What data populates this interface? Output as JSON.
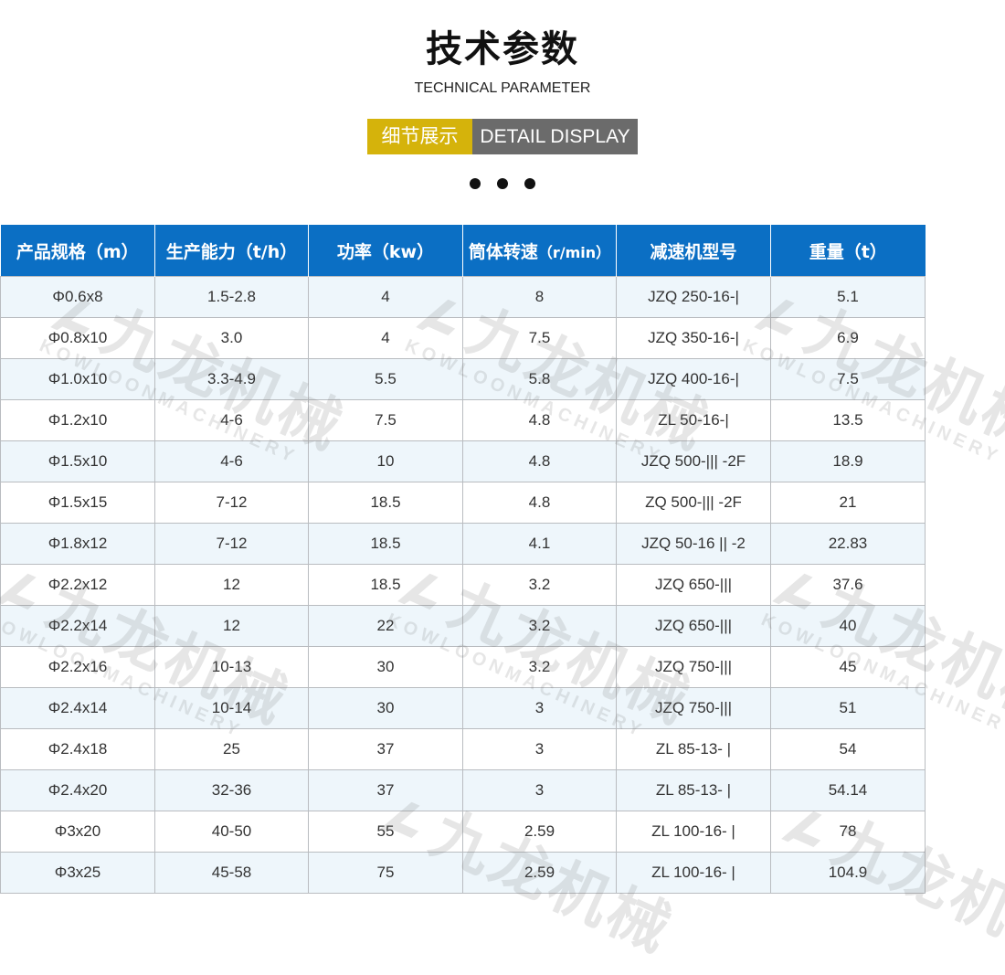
{
  "header": {
    "title": "技术参数",
    "subtitle": "TECHNICAL PARAMETER",
    "banner_cn": "细节展示",
    "banner_en": "DETAIL DISPLAY"
  },
  "watermark": {
    "text_cn": "九龙机械",
    "text_en": "KOWLOONMACHINERY"
  },
  "table": {
    "headers": [
      {
        "main": "产品规格",
        "unit": "（m）"
      },
      {
        "main": "生产能力",
        "unit": "（t/h）"
      },
      {
        "main": "功率",
        "unit": "（kw）"
      },
      {
        "main": "筒体转速",
        "unit": "（r/min）"
      },
      {
        "main": "减速机型号",
        "unit": ""
      },
      {
        "main": "重量",
        "unit": "（t）"
      }
    ],
    "rows": [
      [
        "Φ0.6x8",
        "1.5-2.8",
        "4",
        "8",
        "JZQ 250-16-|",
        "5.1"
      ],
      [
        "Φ0.8x10",
        "3.0",
        "4",
        "7.5",
        "JZQ 350-16-|",
        "6.9"
      ],
      [
        "Φ1.0x10",
        "3.3-4.9",
        "5.5",
        "5.8",
        "JZQ 400-16-|",
        "7.5"
      ],
      [
        "Φ1.2x10",
        "4-6",
        "7.5",
        "4.8",
        "ZL 50-16-|",
        "13.5"
      ],
      [
        "Φ1.5x10",
        "4-6",
        "10",
        "4.8",
        "JZQ 500-||| -2F",
        "18.9"
      ],
      [
        "Φ1.5x15",
        "7-12",
        "18.5",
        "4.8",
        "ZQ 500-||| -2F",
        "21"
      ],
      [
        "Φ1.8x12",
        "7-12",
        "18.5",
        "4.1",
        "JZQ 50-16 || -2",
        "22.83"
      ],
      [
        "Φ2.2x12",
        "12",
        "18.5",
        "3.2",
        "JZQ 650-|||",
        "37.6"
      ],
      [
        "Φ2.2x14",
        "12",
        "22",
        "3.2",
        "JZQ 650-|||",
        "40"
      ],
      [
        "Φ2.2x16",
        "10-13",
        "30",
        "3.2",
        "JZQ 750-|||",
        "45"
      ],
      [
        "Φ2.4x14",
        "10-14",
        "30",
        "3",
        "JZQ 750-|||",
        "51"
      ],
      [
        "Φ2.4x18",
        "25",
        "37",
        "3",
        "ZL 85-13- |",
        "54"
      ],
      [
        "Φ2.4x20",
        "32-36",
        "37",
        "3",
        "ZL 85-13- |",
        "54.14"
      ],
      [
        "Φ3x20",
        "40-50",
        "55",
        "2.59",
        "ZL 100-16- |",
        "78"
      ],
      [
        "Φ3x25",
        "45-58",
        "75",
        "2.59",
        "ZL 100-16- |",
        "104.9"
      ]
    ]
  },
  "colors": {
    "header_bg": "#0b6fc4",
    "banner_gold": "#d5b30b",
    "banner_gray": "#6b6b6b",
    "row_alt": "#eef6fb",
    "border": "#b9bcc0"
  },
  "icons": {
    "watermark_logo": "kowloon-logo-icon"
  }
}
